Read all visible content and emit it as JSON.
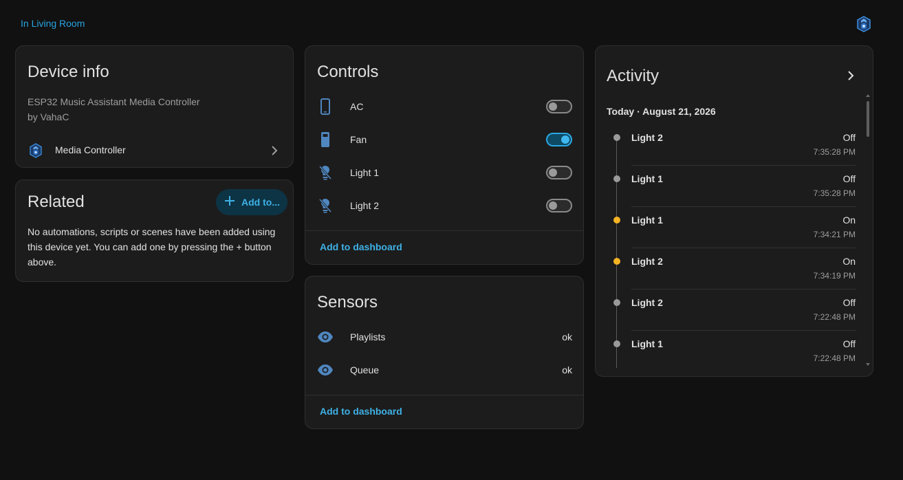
{
  "header": {
    "area_link": "In Living Room",
    "logo_icon": "music-assistant-logo-icon"
  },
  "colors": {
    "background": "#111111",
    "card": "#1c1c1c",
    "accent": "#3fb1e6",
    "state_on": "#f4b324",
    "state_off": "#9a9a9a"
  },
  "device_info": {
    "title": "Device info",
    "model": "ESP32 Music Assistant Media Controller",
    "manufacturer": "by VahaC",
    "device_name": "Media Controller",
    "device_icon": "music-assistant-logo-icon"
  },
  "related": {
    "title": "Related",
    "add_button_label": "Add to...",
    "empty_text": "No automations, scripts or scenes have been added using this device yet. You can add one by pressing the + button above."
  },
  "controls": {
    "title": "Controls",
    "items": [
      {
        "label": "AC",
        "icon": "phone-outline-icon",
        "on": false
      },
      {
        "label": "Fan",
        "icon": "phone-filled-icon",
        "on": true
      },
      {
        "label": "Light 1",
        "icon": "lightbulb-off-icon",
        "on": false
      },
      {
        "label": "Light 2",
        "icon": "lightbulb-off-icon",
        "on": false
      }
    ],
    "add_to_dashboard": "Add to dashboard"
  },
  "sensors": {
    "title": "Sensors",
    "items": [
      {
        "label": "Playlists",
        "value": "ok",
        "icon": "eye-icon"
      },
      {
        "label": "Queue",
        "value": "ok",
        "icon": "eye-icon"
      }
    ],
    "add_to_dashboard": "Add to dashboard"
  },
  "activity": {
    "title": "Activity",
    "date_heading": "Today · August 21, 2026",
    "entries": [
      {
        "name": "Light 2",
        "state": "Off",
        "time": "7:35:28 PM",
        "on": false
      },
      {
        "name": "Light 1",
        "state": "Off",
        "time": "7:35:28 PM",
        "on": false
      },
      {
        "name": "Light 1",
        "state": "On",
        "time": "7:34:21 PM",
        "on": true
      },
      {
        "name": "Light 2",
        "state": "On",
        "time": "7:34:19 PM",
        "on": true
      },
      {
        "name": "Light 2",
        "state": "Off",
        "time": "7:22:48 PM",
        "on": false
      },
      {
        "name": "Light 1",
        "state": "Off",
        "time": "7:22:48 PM",
        "on": false
      }
    ]
  }
}
